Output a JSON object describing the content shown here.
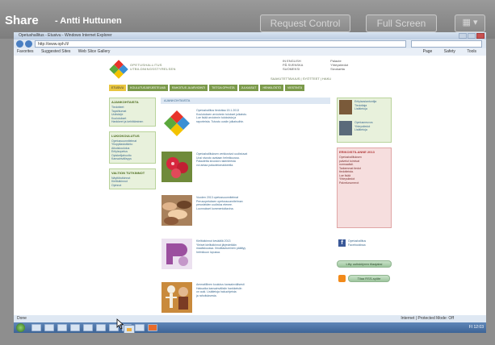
{
  "viewer": {
    "title": "Share",
    "user": "- Antti Huttunen",
    "request_control_label": "Request Control",
    "full_screen_label": "Full Screen",
    "menu_icon": "grid-menu-icon"
  },
  "browser": {
    "title": "Opetushallitus - Etusivu - Windows Internet Explorer",
    "address": "http://www.oph.fi/",
    "favorites": [
      "Favorites",
      "Suggested Sites",
      "Web Slice Gallery"
    ],
    "tools": [
      "Page",
      "Safety",
      "Tools"
    ],
    "status": "Done",
    "zone": "Internet | Protected Mode: Off"
  },
  "site": {
    "logo_text": [
      "OPETUSHALLITUS",
      "UTBILDNINGSSTYRELSEN"
    ],
    "top_links_left": [
      "IN ENGLISH",
      "PÅ SVENSKA",
      "SUOMEKSI"
    ],
    "top_links_right": [
      "Palaute",
      "Yhteystiedot",
      "Sivukartta"
    ],
    "top_sub": "SAAVUTETTAVUUS | SYÖTTEET | HAKU",
    "nav": [
      "ETUSIVU",
      "KOULUTUSJÄRJESTELMÄ",
      "RAHOITUS JA ARVIOINTI",
      "TIETOA OPH:STA",
      "JULKAISUT",
      "HENKILÖSTÖ",
      "VIESTINTÄ"
    ],
    "left_boxes": [
      {
        "head": "AJANKOHTAISTA",
        "lines": [
          "Tiedotteet",
          "Tapahtumat",
          "Uutiskirje",
          "Kuulutukset",
          "Hankkeet ja kehittäminen"
        ]
      },
      {
        "head": "LUKIOKOULUTUS",
        "lines": [
          "Opetussuunnitelmat",
          "Ylioppilastutkinto",
          "Aikuiskoulutus",
          "Erityisopetus",
          "Opiskelijahuolto",
          "Kansainvälisyys"
        ]
      },
      {
        "head": "VALTION TUTKINNOT",
        "lines": [
          "Näyttötutkinnot",
          "Kielitutkinnot",
          "Opinnot"
        ]
      }
    ],
    "main_head": "AJANKOHTAISTA",
    "news": [
      {
        "thumb": "colorful-diamond-logo",
        "lines": [
          "Opetushallitus tiedottaa 15.1.2013",
          "Koulutuksen arvioinnin tulokset julkaistu.",
          "Lue lisää arvioinnin tuloksista ja",
          "raporteista. Tutustu uusiin julkaisuihin."
        ]
      },
      {
        "thumb": "red-flowers-photo",
        "lines": [
          "Opetushallituksen verkkosivut uudistuvat",
          "Uusi sivusto avataan helmikuussa.",
          "Palautetta sivuston rakenteesta",
          "voi antaa palautelomakkeella."
        ]
      },
      {
        "thumb": "hands-together-photo",
        "lines": [
          "Vuoden 2013 opetussuunnitelmat",
          "Perusopetuksen opetussuunnitelman",
          "perusteiden uudistus etenee.",
          "Luonnokset kommentoitavina."
        ]
      },
      {
        "thumb": "purple-shapes-graphic",
        "lines": [
          "Kielitutkinnot keväällä 2013",
          "Yleiset kielitutkinnot järjestetään",
          "maaliskuussa. Ilmoittautuminen päättyy",
          "helmikuun lopussa."
        ]
      },
      {
        "thumb": "skeleton-model-photo",
        "lines": [
          "Ammatillinen koulutus kansainvälisesti",
          "Hakuaika kansainvälisiin hankkeisiin",
          "on auki. Lisätietoja hakuohjeista",
          "ja rahoituksesta."
        ]
      }
    ],
    "people": [
      {
        "name": "Erityisasiantuntija",
        "line2": "Tiedottaja",
        "line3": "Lisätietoja"
      },
      {
        "name": "Opetusneuvos",
        "line2": "Yhteystiedot",
        "line3": "Lisätietoja"
      }
    ],
    "alert": {
      "head": "ERIKOISTILANNE 2013",
      "lines": [
        "Opetushallituksen",
        "palvelut toimivat",
        "normaalisti.",
        "Tarkemmat tiedot",
        "tiedotteista.",
        "Lue lisää",
        "Yhteystiedot",
        "Palvelunumerot"
      ]
    },
    "facebook_text": [
      "Opetushallitus",
      "Facebookissa"
    ],
    "green_button": "Liity uutiskirjeen tilaajaksi",
    "rss_button": "Tilaa RSS-syöte"
  },
  "taskbar": {
    "tray": "FI  12:03"
  }
}
